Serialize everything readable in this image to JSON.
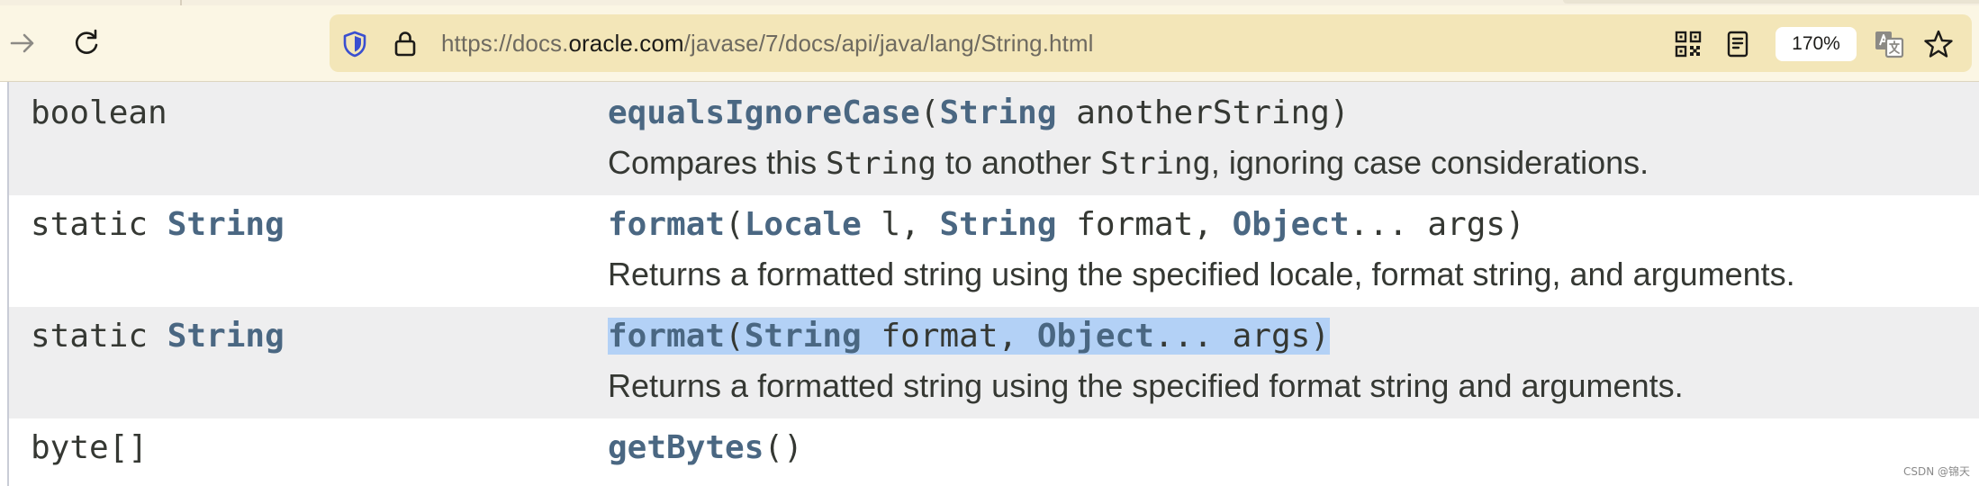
{
  "browser": {
    "url_parts": {
      "prefix": "https://docs.",
      "host": "oracle.com",
      "path": "/javase/7/docs/api/java/lang/String.html"
    },
    "zoom_label": "170%",
    "icons": {
      "forward": "arrow-right-icon",
      "reload": "reload-icon",
      "shield": "shield-icon",
      "lock": "lock-icon",
      "qr": "qr-code-icon",
      "reader": "reader-view-icon",
      "translate": "translate-icon",
      "bookmark": "star-icon"
    },
    "colors": {
      "toolbar_bg": "#fbf6e4",
      "urlbar_bg": "#f3e6b8"
    }
  },
  "methods": [
    {
      "modifier": "",
      "type": "boolean",
      "name": "equalsIgnoreCase",
      "open": "(",
      "params": [
        {
          "type": "String",
          "rest": " anotherString"
        }
      ],
      "close": ")",
      "desc_pre": "Compares this ",
      "desc_code1": "String",
      "desc_mid": " to another ",
      "desc_code2": "String",
      "desc_post": ", ignoring case considerations."
    },
    {
      "modifier": "static ",
      "type": "String",
      "name": "format",
      "open": "(",
      "p1_type": "Locale",
      "p1_rest": " l, ",
      "p2_type": "String",
      "p2_rest": " format, ",
      "p3_type": "Object",
      "p3_rest": "... args",
      "close": ")",
      "description": "Returns a formatted string using the specified locale, format string, and arguments."
    },
    {
      "modifier": "static ",
      "type": "String",
      "name": "format",
      "open": "(",
      "p1_type": "String",
      "p1_rest": " format, ",
      "p2_type": "Object",
      "p2_rest": "... args",
      "close": ")",
      "description": "Returns a formatted string using the specified format string and arguments."
    },
    {
      "modifier": "",
      "type": "byte[]",
      "name": "getBytes",
      "open": "(",
      "close": ")"
    }
  ],
  "colors": {
    "link": "#4a6782",
    "text": "#353833",
    "row_alt_bg": "#eeeeef",
    "selection_bg": "#b3d1f6"
  },
  "watermark": "CSDN @锦天"
}
